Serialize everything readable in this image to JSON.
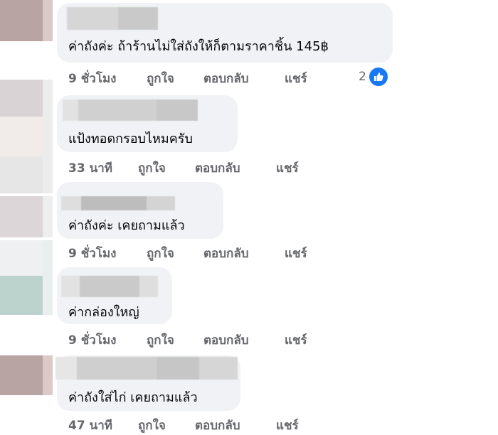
{
  "comments": [
    {
      "text": "ค่าถังค่ะ ถ้าร้านไม่ใส่ถังให้ก็ตามราคาชิ้น 145฿",
      "time": "9 ชั่วโมง",
      "like": "ถูกใจ",
      "reply": "ตอบกลับ",
      "share": "แชร์",
      "reactions": "2"
    },
    {
      "text": "แป้งทอดกรอบไหมครับ",
      "time": "33 นาที",
      "like": "ถูกใจ",
      "reply": "ตอบกลับ",
      "share": "แชร์"
    },
    {
      "text": "ค่าถังค่ะ เคยถามแล้ว",
      "time": "9 ชั่วโมง",
      "like": "ถูกใจ",
      "reply": "ตอบกลับ",
      "share": "แชร์"
    },
    {
      "text": "ค่ากล่องใหญ่",
      "time": "9 ชั่วโมง",
      "like": "ถูกใจ",
      "reply": "ตอบกลับ",
      "share": "แชร์"
    },
    {
      "text": "ค่าถังใส่ไก่ เคยถามแล้ว",
      "time": "47 นาที",
      "like": "ถูกใจ",
      "reply": "ตอบกลับ",
      "share": "แชร์"
    }
  ],
  "icons": {
    "reaction": "like-icon"
  },
  "colors": {
    "bubble": "#f0f2f5",
    "action_text": "#65676b",
    "like_blue": "#1877f2"
  }
}
